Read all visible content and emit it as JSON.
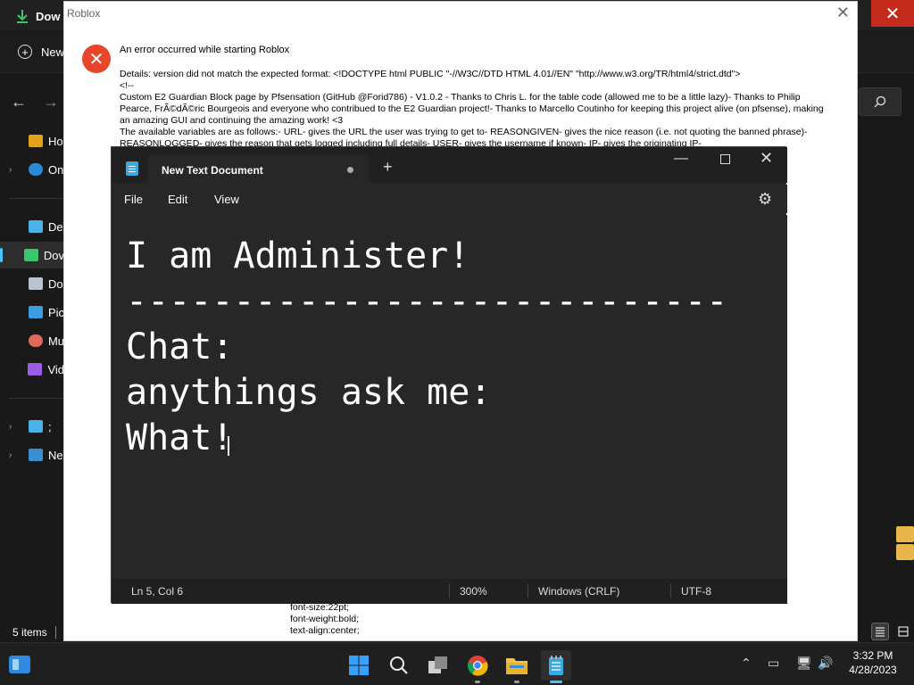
{
  "explorer": {
    "tab_label": "Dow",
    "new_label": "New",
    "nav_items": [
      {
        "label": "Ho",
        "icon": "home-icon"
      },
      {
        "label": "On",
        "icon": "onedrive-cloud-icon"
      },
      {
        "label": "De",
        "icon": "desktop-folder-icon"
      },
      {
        "label": "Dov",
        "icon": "downloads-icon"
      },
      {
        "label": "Do",
        "icon": "documents-icon"
      },
      {
        "label": "Pic",
        "icon": "pictures-icon"
      },
      {
        "label": "Mu",
        "icon": "music-icon"
      },
      {
        "label": "Vid",
        "icon": "videos-icon"
      },
      {
        "label": ";",
        "icon": "this-pc-icon"
      },
      {
        "label": "Ne",
        "icon": "network-icon"
      }
    ],
    "status_text": "5 items"
  },
  "roblox_dialog": {
    "title": "Roblox",
    "message": "An error occurred while starting Roblox",
    "details": [
      "Details: version did not match the expected format: <!DOCTYPE html PUBLIC \"-//W3C//DTD HTML 4.01//EN\" \"http://www.w3.org/TR/html4/strict.dtd\">",
      "<!--",
      "Custom E2 Guardian Block page by Pfsensation (GitHub @Forid786) - V1.0.2 - Thanks to Chris L. for the table code (allowed me to be a little lazy)- Thanks to Philip Pearce, FrÃ©dÃ©ric Bourgeois and everyone who contribued to the E2 Guardian project!- Thanks to Marcello Coutinho for keeping this project alive (on pfsense), making an amazing GUI and continuing the amazing work! <3",
      "The available variables are as follows:- URL- gives the URL the user was trying to get to- REASONGIVEN- gives the nice reason (i.e. not quoting the banned phrase)- REASONLOGGED- gives the reason that gets logged including full details- USER- gives the username if known- IP- gives the originating IP-"
    ],
    "code_lines": [
      "font-size:22pt;",
      "font-weight:bold;",
      "text-align:center;"
    ]
  },
  "notepad": {
    "tab_title": "New Text Document",
    "menu": {
      "file": "File",
      "edit": "Edit",
      "view": "View"
    },
    "lines": [
      "I am Administer!",
      "----------------------------",
      "Chat:",
      "anythings ask me:",
      "What!"
    ],
    "status": {
      "position": "Ln 5, Col 6",
      "zoom": "300%",
      "line_ending": "Windows (CRLF)",
      "encoding": "UTF-8"
    }
  },
  "taskbar": {
    "time": "3:32 PM",
    "date": "4/28/2023",
    "apps": [
      "start-icon",
      "search-icon",
      "task-view-icon",
      "chrome-icon",
      "file-explorer-icon",
      "notepad-icon"
    ]
  },
  "colors": {
    "accent": "#4cc2ff",
    "error_red": "#e8452a",
    "close_red": "#c42b1c",
    "notepad_bg": "#272727"
  }
}
